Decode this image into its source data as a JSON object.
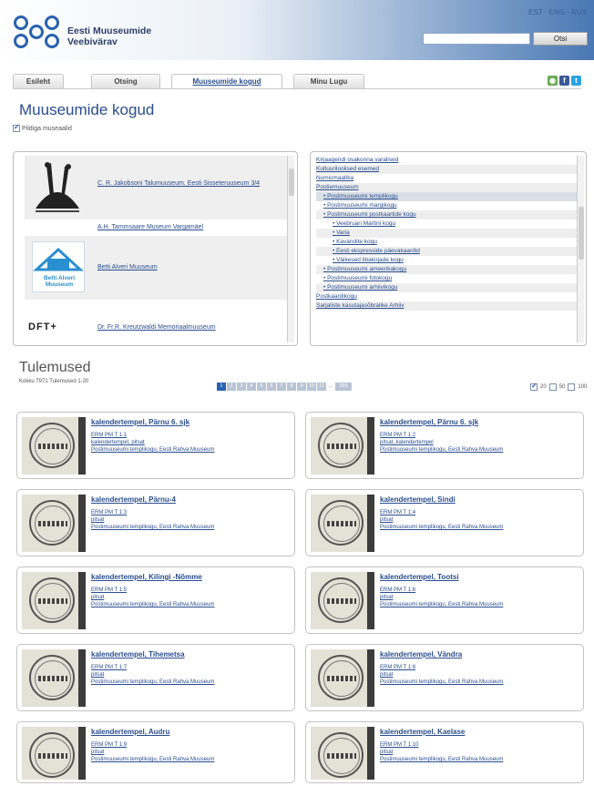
{
  "header": {
    "languages": "EST · ENG · RUS",
    "site_title_line1": "Eesti Muuseumide",
    "site_title_line2": "Veebivärav",
    "search_placeholder": "",
    "search_button": "Otsi"
  },
  "nav": {
    "tabs": [
      "Esileht",
      "Otsing",
      "Muuseumide kogud",
      "Minu Lugu"
    ],
    "active_index": 2
  },
  "social_icons": [
    "rss-icon",
    "facebook-icon",
    "twitter-icon"
  ],
  "page": {
    "title": "Muuseumide kogud",
    "checkbox_label": "Pildiga museaalid"
  },
  "museums": [
    {
      "label": "C. R. Jakobsoni Talumuuseum. Eesti Sisseteruuseum 3/4",
      "icon": "storks-logo-icon"
    },
    {
      "label": "A.H. Tammsaare Museum Vargamäel",
      "icon": ""
    },
    {
      "label": "Betti Alveri Muuseum",
      "icon": "betti-alveri-muuseum-logo-icon"
    },
    {
      "label": "Dr. Fr.R. Kreutzwaldi Memoriaalmuuseum",
      "icon": "dft-logo-icon"
    }
  ],
  "museum_logo_texts": {
    "betti": "Betti Alveri Muuseum",
    "dft": "DFT+"
  },
  "categories": [
    "Kirjaagendi osakonna varalised",
    "Kultuuriloolised esemed",
    "Numismaatika",
    "Postiemuuseum",
    "• Postimuuseumi templikogu",
    "• Postimuuseumi margikogu",
    "• Postimuuseumi postkaartide kogu",
    "• Veebruari Martini kogu",
    "• Varia",
    "• Kavandite kogu",
    "• Eesti ekspresside päevakaardid",
    "• Väikesed libakirjade kogu",
    "• Postimuuseumi ameerikakogu",
    "• Postimuuseumi fotokogu",
    "• Postimuuseumi arhiivikogu",
    "Postkaardikogu",
    "Sarjaliste kasutajasõbralike Arhiiv"
  ],
  "results": {
    "title": "Tulemused",
    "info": "Kokku 7971 Tulemused 1-20",
    "pages": [
      "1",
      "2",
      "3",
      "4",
      "5",
      "6",
      "7",
      "8",
      "9",
      "10",
      "11",
      "...",
      "399"
    ],
    "active_page": 0,
    "view_options": [
      "20",
      "50",
      "100"
    ]
  },
  "cards": [
    {
      "title": "kalendertempel, Pärnu 6. sjk",
      "code": "ERM PM T 1:1",
      "line2": "kalendertempel, pitsat",
      "line3": "Postimuuseumi templikogu, Eesti Rahva Muuseum"
    },
    {
      "title": "kalendertempel, Pärnu 6. sjk",
      "code": "ERM PM T 1:2",
      "line2": "pitsat, kalendertempel",
      "line3": "Postimuuseumi templikogu, Eesti Rahva Muuseum"
    },
    {
      "title": "kalendertempel, Pärnu-4",
      "code": "ERM PM T 1:3",
      "line2": "pitsat",
      "line3": "Postimuuseumi templikogu, Eesti Rahva Muuseum"
    },
    {
      "title": "kalendertempel, Sindi",
      "code": "ERM PM T 1:4",
      "line2": "pitsat",
      "line3": "Postimuuseumi templikogu, Eesti Rahva Muuseum"
    },
    {
      "title": "kalendertempel, Kilingi -Nõmme",
      "code": "ERM PM T 1:5",
      "line2": "pitsat",
      "line3": "Postimuuseumi templikogu, Eesti Rahva Muuseum"
    },
    {
      "title": "kalendertempel, Tootsi",
      "code": "ERM PM T 1:6",
      "line2": "pitsat",
      "line3": "Postimuuseumi templikogu, Eesti Rahva Muuseum"
    },
    {
      "title": "kalendertempel, Tihemetsa",
      "code": "ERM PM T 1:7",
      "line2": "pitsat",
      "line3": "Postimuuseumi templikogu, Eesti Rahva Muuseum"
    },
    {
      "title": "kalendertempel, Vändra",
      "code": "ERM PM T 1:8",
      "line2": "pitsat",
      "line3": "Postimuuseumi templikogu, Eesti Rahva Muuseum"
    },
    {
      "title": "kalendertempel, Audru",
      "code": "ERM PM T 1:9",
      "line2": "pitsat",
      "line3": "Postimuuseumi templikogu, Eesti Rahva Muuseum"
    },
    {
      "title": "kalendertempel, Kaelase",
      "code": "ERM PM T 1:10",
      "line2": "pitsat",
      "line3": "Postimuuseumi templikogu, Eesti Rahva Muuseum"
    }
  ],
  "colors": {
    "accent": "#2a4d8f",
    "header_gradient_end": "#4a78b4",
    "pager_active": "#2a62b0"
  }
}
